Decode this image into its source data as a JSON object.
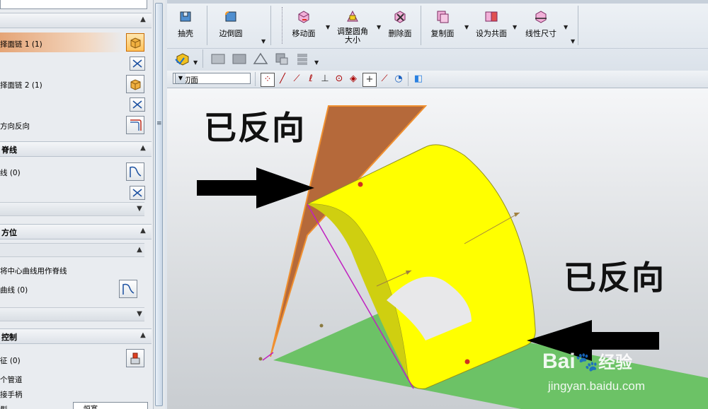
{
  "panel": {
    "top_label": "择面链 1 (1)",
    "chain2_label": "择面链 2 (1)",
    "reverse_label": "方向反向",
    "section_spine": "脊线",
    "spine_curve_label": "线 (0)",
    "section_position": "方位",
    "use_center_curve_label": "将中心曲线用作脊线",
    "curve_label": "曲线 (0)",
    "section_control": "控制",
    "feature_label": "征 (0)",
    "pipe_label": "个管道",
    "handle_label": "接手柄",
    "type_label": "型",
    "type_value": "恒宽"
  },
  "ribbon": {
    "tools": [
      {
        "label": "抽壳",
        "icon": "shell-icon"
      },
      {
        "label": "边倒圆",
        "icon": "edge-blend-icon"
      },
      {
        "label": "移动面",
        "icon": "move-face-icon"
      },
      {
        "label": "调整圆角",
        "label2": "大小",
        "icon": "resize-blend-icon"
      },
      {
        "label": "删除面",
        "icon": "delete-face-icon"
      },
      {
        "label": "复制面",
        "icon": "copy-face-icon"
      },
      {
        "label": "设为共面",
        "icon": "make-coplanar-icon"
      },
      {
        "label": "线性尺寸",
        "icon": "linear-dimension-icon"
      }
    ],
    "filter_value": "相切面"
  },
  "viewport": {
    "note_top": "已反向",
    "note_bottom": "已反向",
    "watermark_brand": "Bai",
    "watermark_brand2": "经验",
    "watermark_url": "jingyan.baidu.com"
  },
  "colors": {
    "face_yellow": "#ffff00",
    "face_orange": "#b5693a",
    "face_green": "#6cc266",
    "arrow_black": "#000000"
  }
}
